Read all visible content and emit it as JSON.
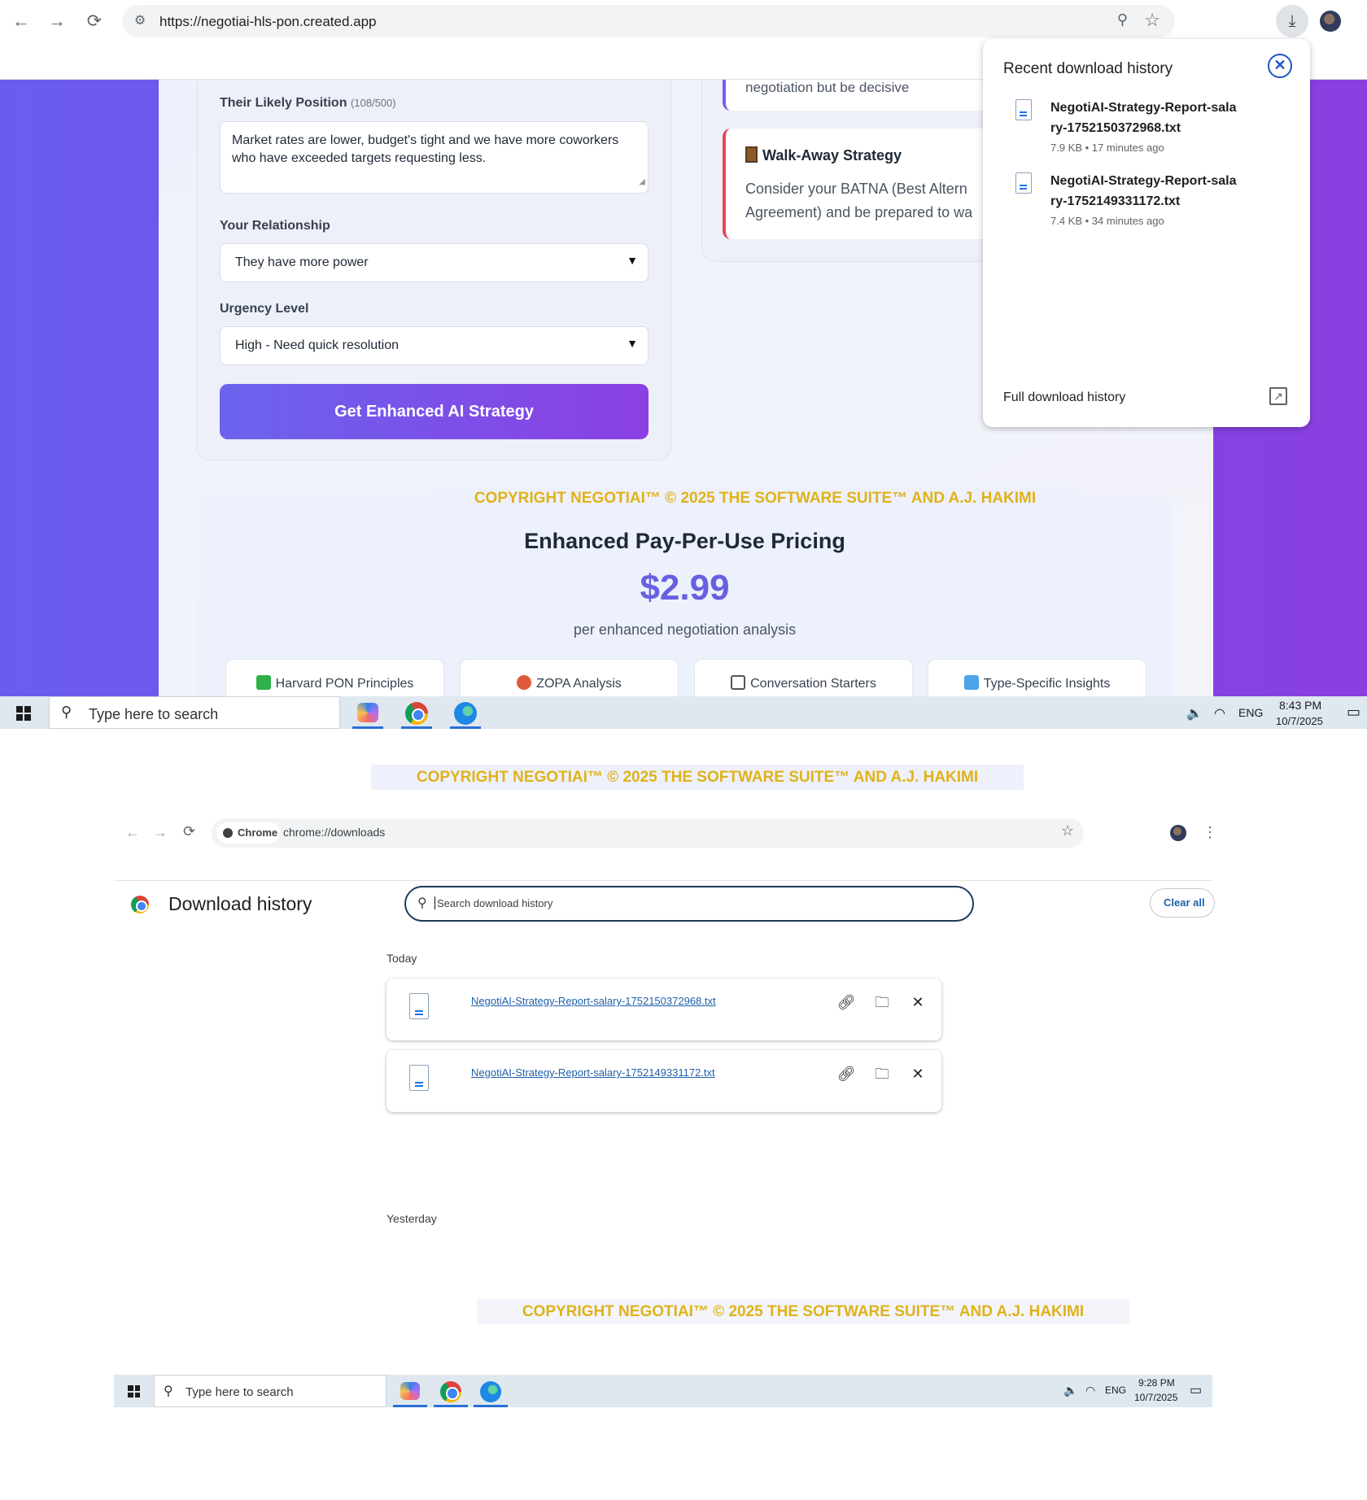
{
  "top_window": {
    "browser": {
      "url": "https://negotiai-hls-pon.created.app",
      "nav_back": "←",
      "nav_forward": "→",
      "reload": "⟳"
    },
    "form": {
      "their_position_label": "Their Likely Position",
      "their_position_count": "(108/500)",
      "their_position_value": "Market rates are lower, budget's tight and we have more coworkers who have exceeded targets requesting less.",
      "relationship_label": "Your Relationship",
      "relationship_value": "They have more power",
      "urgency_label": "Urgency Level",
      "urgency_value": "High - Need quick resolution",
      "cta_label": "Get Enhanced AI Strategy"
    },
    "tips": {
      "top_fragment": "negotiation but be decisive",
      "walkaway_title": "Walk-Away Strategy",
      "walkaway_line1": "Consider your BATNA (Best Altern",
      "walkaway_line2": "Agreement) and be prepared to wa"
    },
    "copyright": "COPYRIGHT NEGOTIAI™ © 2025 THE SOFTWARE SUITE™ AND A.J. HAKIMI",
    "pricing": {
      "title": "Enhanced Pay-Per-Use Pricing",
      "price": "$2.99",
      "subtitle": "per enhanced negotiation analysis",
      "features": [
        "Harvard PON Principles",
        "ZOPA Analysis",
        "Conversation Starters",
        "Type-Specific Insights"
      ]
    },
    "download_popup": {
      "title": "Recent download history",
      "items": [
        {
          "name": "NegotiAI-Strategy-Report-salary-1752150372968.txt",
          "meta": "7.9 KB • 17 minutes ago"
        },
        {
          "name": "NegotiAI-Strategy-Report-salary-1752149331172.txt",
          "meta": "7.4 KB • 34 minutes ago"
        }
      ],
      "full_history": "Full download history"
    },
    "taskbar": {
      "search_placeholder": "Type here to search",
      "lang": "ENG",
      "time": "8:43 PM",
      "date": "10/7/2025"
    }
  },
  "middle_copyright": "COPYRIGHT NEGOTIAI™ © 2025 THE SOFTWARE SUITE™ AND A.J. HAKIMI",
  "bottom_window": {
    "browser": {
      "chip_label": "Chrome",
      "url": "chrome://downloads"
    },
    "page_title": "Download history",
    "search_placeholder": "Search download history",
    "clear_all": "Clear all",
    "today_label": "Today",
    "yesterday_label": "Yesterday",
    "files": [
      "NegotiAI-Strategy-Report-salary-1752150372968.txt",
      "NegotiAI-Strategy-Report-salary-1752149331172.txt"
    ],
    "copyright": "COPYRIGHT NEGOTIAI™ © 2025 THE SOFTWARE SUITE™ AND A.J. HAKIMI",
    "taskbar": {
      "search_placeholder": "Type here to search",
      "lang": "ENG",
      "time": "9:28 PM",
      "date": "10/7/2025"
    }
  },
  "colors": {
    "accent_purple": "#6a5fe0",
    "page_gradient_start": "#6b5cf0",
    "page_gradient_end": "#8a3fe0",
    "copyright_gold": "#e0b21a",
    "walkaway_border": "#e0475b",
    "link_blue": "#1f5fa8"
  },
  "icons": [
    "search-icon",
    "star-icon",
    "download-icon",
    "close-icon",
    "file-icon",
    "external-link-icon",
    "link-icon",
    "folder-icon",
    "windows-start-icon",
    "chrome-icon",
    "edge-icon",
    "copilot-icon",
    "speaker-icon",
    "wifi-icon",
    "notifications-icon"
  ]
}
